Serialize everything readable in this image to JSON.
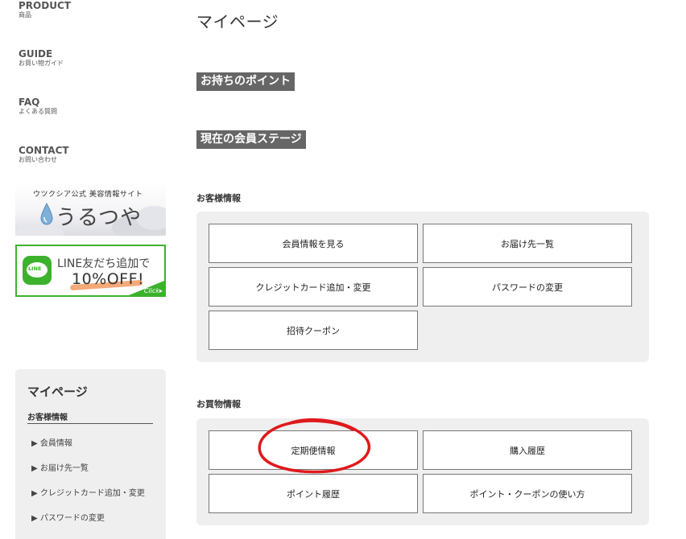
{
  "nav": [
    {
      "label": "PRODUCT",
      "sub": "商品"
    },
    {
      "label": "GUIDE",
      "sub": "お買い物ガイド"
    },
    {
      "label": "FAQ",
      "sub": "よくある質問"
    },
    {
      "label": "CONTACT",
      "sub": "お問い合わせ"
    }
  ],
  "banner_urutsuya": {
    "top_text": "ウツクシア公式 美容情報サイト",
    "logo_text": "うるつや"
  },
  "banner_line": {
    "icon_text": "LINE",
    "text1": "LINE友だち追加で",
    "text2": "10%OFF!",
    "click": "Click▸"
  },
  "sidebar": {
    "title": "マイページ",
    "section": "お客様情報",
    "links": [
      "▶ 会員情報",
      "▶ お届け先一覧",
      "▶ クレジットカード追加・変更",
      "▶ パスワードの変更"
    ]
  },
  "main": {
    "title": "マイページ",
    "points_label": "お持ちのポイント",
    "stage_label": "現在の会員ステージ",
    "customer": {
      "heading": "お客様情報",
      "buttons": [
        "会員情報を見る",
        "お届け先一覧",
        "クレジットカード追加・変更",
        "パスワードの変更",
        "招待クーポン"
      ]
    },
    "shopping": {
      "heading": "お買物情報",
      "buttons": [
        "定期便情報",
        "購入履歴",
        "ポイント履歴",
        "ポイント・クーポンの使い方"
      ]
    }
  },
  "colors": {
    "label_bg": "#666666",
    "panel_bg": "#efefef",
    "line_green": "#3cb22c",
    "annotation_red": "#e0191c"
  }
}
